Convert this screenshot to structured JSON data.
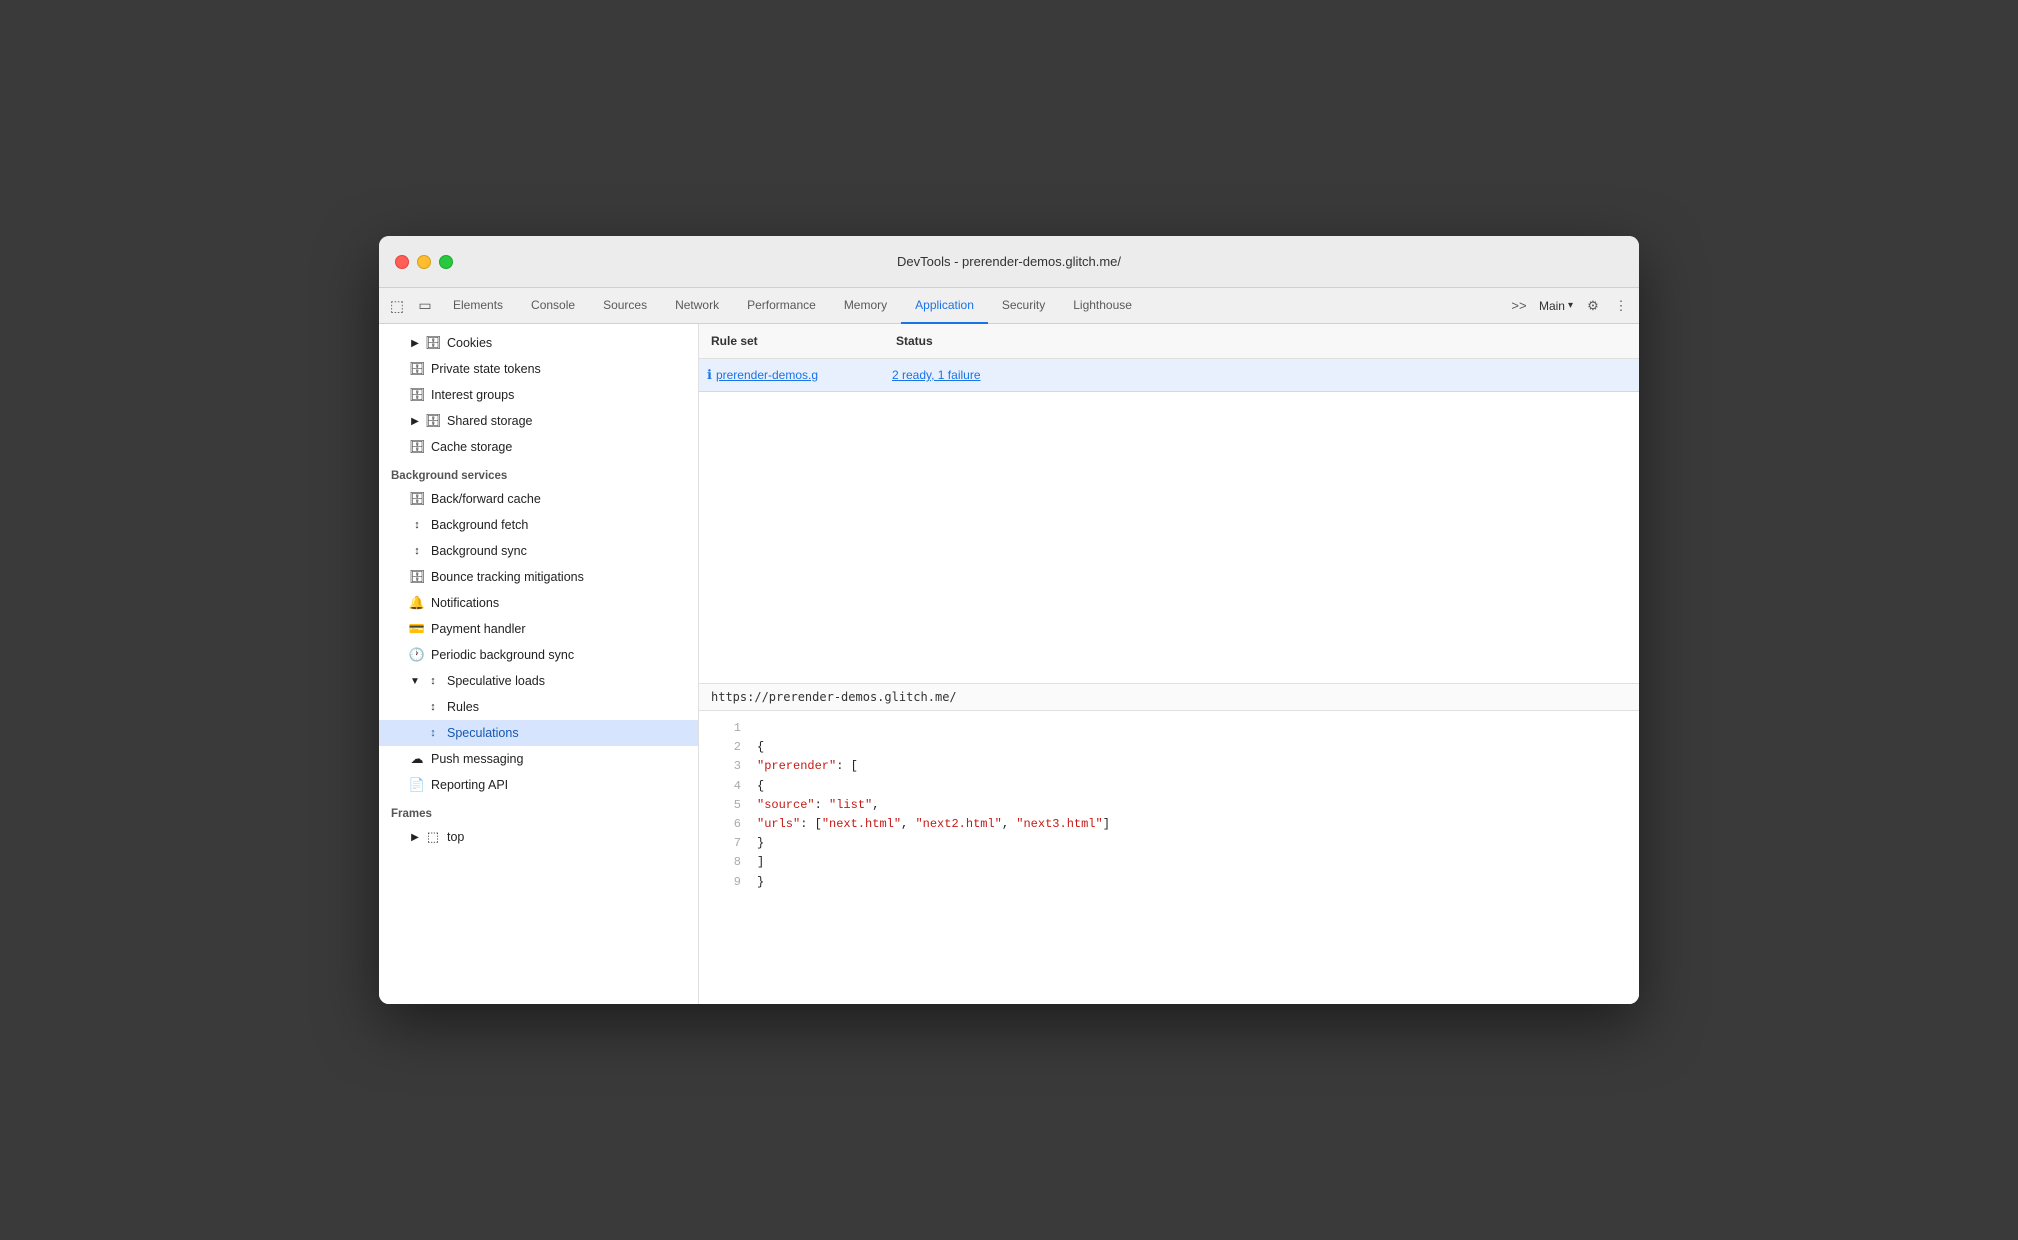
{
  "window": {
    "title": "DevTools - prerender-demos.glitch.me/"
  },
  "titlebar": {
    "title": "DevTools - prerender-demos.glitch.me/"
  },
  "tabs": [
    {
      "id": "elements",
      "label": "Elements",
      "active": false
    },
    {
      "id": "console",
      "label": "Console",
      "active": false
    },
    {
      "id": "sources",
      "label": "Sources",
      "active": false
    },
    {
      "id": "network",
      "label": "Network",
      "active": false
    },
    {
      "id": "performance",
      "label": "Performance",
      "active": false
    },
    {
      "id": "memory",
      "label": "Memory",
      "active": false
    },
    {
      "id": "application",
      "label": "Application",
      "active": true
    },
    {
      "id": "security",
      "label": "Security",
      "active": false
    },
    {
      "id": "lighthouse",
      "label": "Lighthouse",
      "active": false
    }
  ],
  "toolbar": {
    "more_tabs": ">>",
    "main_label": "Main",
    "settings_icon": "⚙",
    "more_icon": "⋮"
  },
  "sidebar": {
    "sections": [
      {
        "id": "storage",
        "items": [
          {
            "id": "cookies",
            "label": "Cookies",
            "icon": "cylinder",
            "indent": 1,
            "arrow": "closed",
            "active": false
          },
          {
            "id": "private-state-tokens",
            "label": "Private state tokens",
            "icon": "cylinder",
            "indent": 1,
            "active": false
          },
          {
            "id": "interest-groups",
            "label": "Interest groups",
            "icon": "cylinder",
            "indent": 1,
            "active": false
          },
          {
            "id": "shared-storage",
            "label": "Shared storage",
            "icon": "cylinder",
            "indent": 1,
            "arrow": "closed",
            "active": false
          },
          {
            "id": "cache-storage",
            "label": "Cache storage",
            "icon": "cylinder",
            "indent": 1,
            "active": false
          }
        ]
      },
      {
        "id": "background-services",
        "header": "Background services",
        "items": [
          {
            "id": "back-forward-cache",
            "label": "Back/forward cache",
            "icon": "cylinder",
            "indent": 1,
            "active": false
          },
          {
            "id": "background-fetch",
            "label": "Background fetch",
            "icon": "arrows",
            "indent": 1,
            "active": false
          },
          {
            "id": "background-sync",
            "label": "Background sync",
            "icon": "arrows",
            "indent": 1,
            "active": false
          },
          {
            "id": "bounce-tracking",
            "label": "Bounce tracking mitigations",
            "icon": "cylinder",
            "indent": 1,
            "active": false
          },
          {
            "id": "notifications",
            "label": "Notifications",
            "icon": "bell",
            "indent": 1,
            "active": false
          },
          {
            "id": "payment-handler",
            "label": "Payment handler",
            "icon": "card",
            "indent": 1,
            "active": false
          },
          {
            "id": "periodic-background-sync",
            "label": "Periodic background sync",
            "icon": "clock",
            "indent": 1,
            "active": false
          },
          {
            "id": "speculative-loads",
            "label": "Speculative loads",
            "icon": "arrows",
            "indent": 1,
            "arrow": "open",
            "active": false
          },
          {
            "id": "rules",
            "label": "Rules",
            "icon": "arrows",
            "indent": 2,
            "active": false
          },
          {
            "id": "speculations",
            "label": "Speculations",
            "icon": "arrows",
            "indent": 2,
            "active": true
          },
          {
            "id": "push-messaging",
            "label": "Push messaging",
            "icon": "cloud",
            "indent": 1,
            "active": false
          },
          {
            "id": "reporting-api",
            "label": "Reporting API",
            "icon": "doc",
            "indent": 1,
            "active": false
          }
        ]
      },
      {
        "id": "frames",
        "header": "Frames",
        "items": [
          {
            "id": "top",
            "label": "top",
            "icon": "frame",
            "indent": 1,
            "arrow": "closed",
            "active": false
          }
        ]
      }
    ]
  },
  "table": {
    "col_ruleset": "Rule set",
    "col_status": "Status",
    "row": {
      "ruleset_url": "prerender-demos.g",
      "status_text": "2 ready, 1 failure"
    }
  },
  "json_panel": {
    "url": "https://prerender-demos.glitch.me/",
    "lines": [
      {
        "num": "1",
        "content": ""
      },
      {
        "num": "2",
        "content": "        {"
      },
      {
        "num": "3",
        "content": "          \"prerender\": ["
      },
      {
        "num": "4",
        "content": "            {"
      },
      {
        "num": "5",
        "content": "              \"source\": \"list\","
      },
      {
        "num": "6",
        "content": "              \"urls\": [\"next.html\", \"next2.html\", \"next3.html\"]"
      },
      {
        "num": "7",
        "content": "            }"
      },
      {
        "num": "8",
        "content": "          ]"
      },
      {
        "num": "9",
        "content": "        }"
      }
    ]
  }
}
